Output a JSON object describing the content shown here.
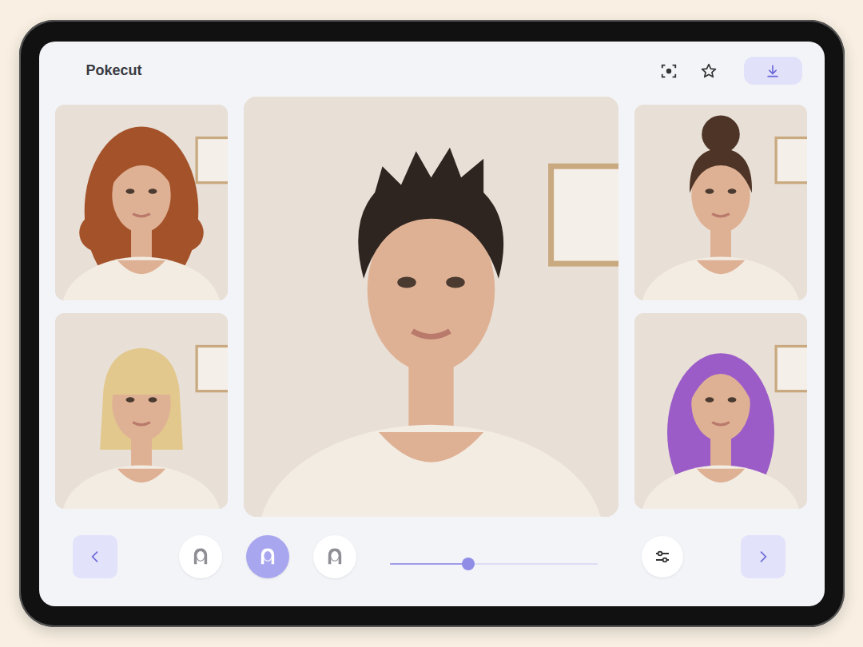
{
  "app": {
    "title": "Pokecut"
  },
  "thumbnails": [
    {
      "kind": "curly",
      "color": "#a4522a"
    },
    {
      "kind": "bangs",
      "color": "#e2c88c"
    },
    {
      "kind": "bun",
      "color": "#4e3426"
    },
    {
      "kind": "wavy",
      "color": "#9b5cc8"
    }
  ],
  "preview": {
    "kind": "pixie",
    "color": "#2f2520"
  },
  "hairstyle_options": [
    {
      "selected": false
    },
    {
      "selected": true
    },
    {
      "selected": false
    }
  ],
  "slider": {
    "level": 0.38
  }
}
